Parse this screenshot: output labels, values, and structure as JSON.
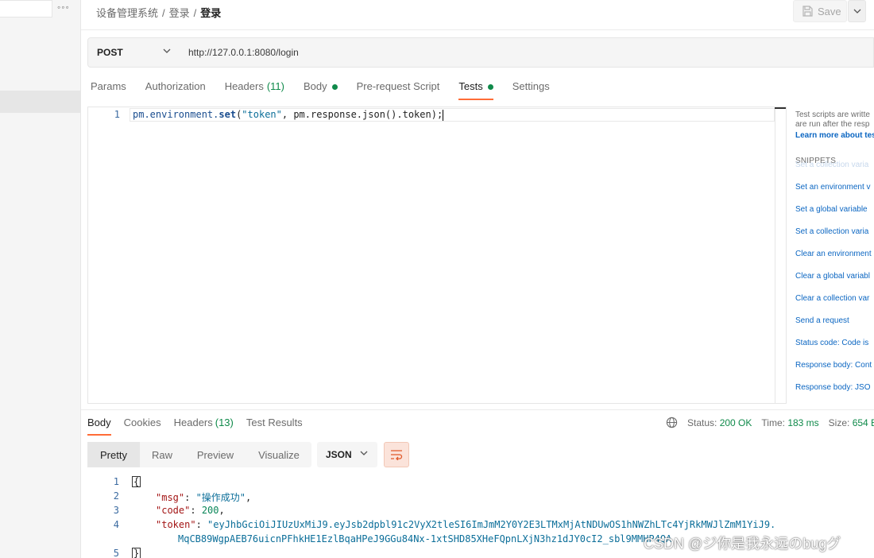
{
  "breadcrumb": {
    "collection": "设备管理系统",
    "folder": "登录",
    "request": "登录",
    "separator": "/"
  },
  "toolbar": {
    "save_label": "Save"
  },
  "request": {
    "method": "POST",
    "url": "http://127.0.0.1:8080/login"
  },
  "request_tabs": [
    {
      "label": "Params"
    },
    {
      "label": "Authorization"
    },
    {
      "label": "Headers",
      "count": "(11)"
    },
    {
      "label": "Body",
      "dot": true
    },
    {
      "label": "Pre-request Script"
    },
    {
      "label": "Tests",
      "dot": true,
      "active": true
    },
    {
      "label": "Settings"
    }
  ],
  "editor": {
    "line_number": "1",
    "code": {
      "p1": "pm.environment.",
      "fn": "set",
      "p2": "(",
      "str": "\"token\"",
      "p3": ", pm.response.json().token);"
    }
  },
  "snippets": {
    "desc_line1": "Test scripts are writte",
    "desc_line2": "are run after the resp",
    "learn_more": "Learn more about tes",
    "heading": "SNIPPETS",
    "ghost": "Set a collection varia",
    "items": [
      "Set an environment v",
      "Set a global variable",
      "Set a collection varia",
      "Clear an environment",
      "Clear a global variabl",
      "Clear a collection var",
      "Send a request",
      "Status code: Code is",
      "Response body: Cont",
      "Response body: JSO"
    ]
  },
  "response_tabs": [
    {
      "label": "Body",
      "active": true
    },
    {
      "label": "Cookies"
    },
    {
      "label": "Headers",
      "count": "(13)"
    },
    {
      "label": "Test Results"
    }
  ],
  "response_meta": {
    "status_label": "Status:",
    "status_value": "200 OK",
    "time_label": "Time:",
    "time_value": "183 ms",
    "size_label": "Size:",
    "size_value": "654 B"
  },
  "view_modes": [
    "Pretty",
    "Raw",
    "Preview",
    "Visualize"
  ],
  "format": "JSON",
  "response_body": {
    "l1": "1",
    "l2": "2",
    "l3": "3",
    "l4": "4",
    "l5": "5",
    "open": "{",
    "close": "}",
    "msg_key": "\"msg\"",
    "msg_val": "\"操作成功\"",
    "code_key": "\"code\"",
    "code_val": "200",
    "token_key": "\"token\"",
    "token_val_1": "\"eyJhbGciOiJIUzUxMiJ9.eyJsb2dpbl91c2VyX2tleSI6ImJmM2Y0Y2E3LTMxMjAtNDUwOS1hNWZhLTc4YjRkMWJlZmM1YiJ9.",
    "token_val_2": "MqCB89WgpAEB76uicnPFhkHE1EzlBqaHPeJ9GGu84Nx-1xtSHD85XHeFQpnLXjN3hz1dJY0cI2_sbl9MMHP4QA"
  },
  "watermark": "CSDN @ジ你是我永远のbugグ"
}
